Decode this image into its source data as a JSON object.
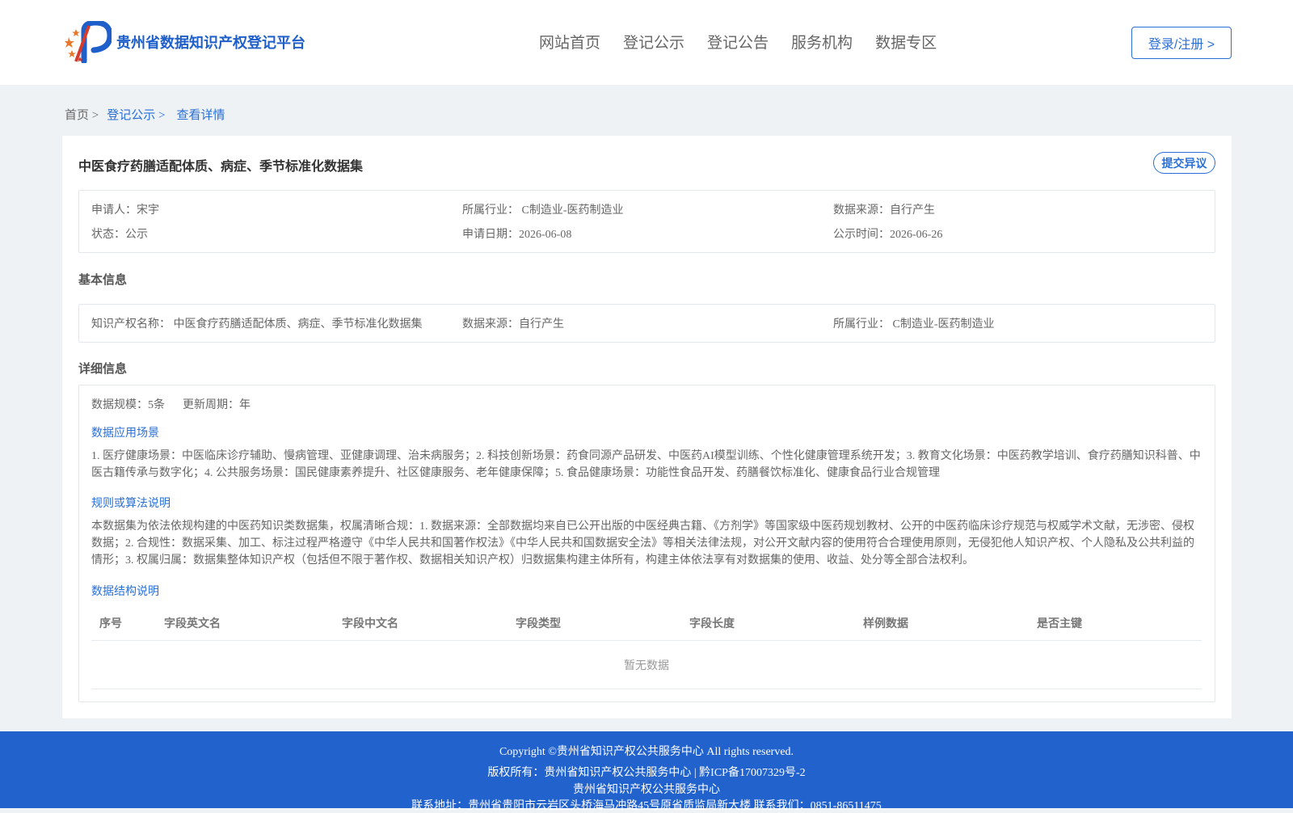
{
  "header": {
    "logo_text": "贵州省数据知识产权登记平台",
    "nav": [
      "网站首页",
      "登记公示",
      "登记公告",
      "服务机构",
      "数据专区"
    ],
    "login_label": "登录/注册 >"
  },
  "breadcrumb": {
    "home": "首页 >",
    "parent": "登记公示 >",
    "current": "查看详情"
  },
  "detail": {
    "title": "中医食疗药膳适配体质、病症、季节标准化数据集",
    "objection_label": "提交异议",
    "summary": {
      "applicant": "申请人：宋宇",
      "industry": "所属行业： C制造业-医药制造业",
      "source": "数据来源：自行产生",
      "status": "状态：公示",
      "apply_date": "申请日期：2026-06-08",
      "publish_time": "公示时间：2026-06-26"
    },
    "basic_title": "基本信息",
    "basic": {
      "ip_name": "知识产权名称： 中医食疗药膳适配体质、病症、季节标准化数据集",
      "source": "数据来源：自行产生",
      "industry": "所属行业： C制造业-医药制造业"
    },
    "detail_title": "详细信息",
    "scale": "数据规模：5条",
    "cycle": "更新周期：年",
    "scenario_title": "数据应用场景",
    "scenario_text": "1. 医疗健康场景：中医临床诊疗辅助、慢病管理、亚健康调理、治未病服务；2. 科技创新场景：药食同源产品研发、中医药AI模型训练、个性化健康管理系统开发；3. 教育文化场景：中医药教学培训、食疗药膳知识科普、中医古籍传承与数字化；4. 公共服务场景：国民健康素养提升、社区健康服务、老年健康保障；5. 食品健康场景：功能性食品开发、药膳餐饮标准化、健康食品行业合规管理",
    "rules_title": "规则或算法说明",
    "rules_text": "本数据集为依法依规构建的中医药知识类数据集，权属清晰合规：1. 数据来源：全部数据均来自已公开出版的中医经典古籍、《方剂学》等国家级中医药规划教材、公开的中医药临床诊疗规范与权威学术文献，无涉密、侵权数据；2. 合规性：数据采集、加工、标注过程严格遵守《中华人民共和国著作权法》《中华人民共和国数据安全法》等相关法律法规，对公开文献内容的使用符合合理使用原则，无侵犯他人知识产权、个人隐私及公共利益的情形；3. 权属归属：数据集整体知识产权（包括但不限于著作权、数据相关知识产权）归数据集构建主体所有，构建主体依法享有对数据集的使用、收益、处分等全部合法权利。",
    "structure_title": "数据结构说明",
    "table_headers": [
      "序号",
      "字段英文名",
      "字段中文名",
      "字段类型",
      "字段长度",
      "样例数据",
      "是否主键"
    ],
    "empty_text": "暂无数据"
  },
  "footer": {
    "copyright": "Copyright ©贵州省知识产权公共服务中心 All rights reserved.",
    "rights": "版权所有：贵州省知识产权公共服务中心 | 黔ICP备17007329号-2",
    "org": "贵州省知识产权公共服务中心",
    "address": "联系地址：贵州省贵阳市云岩区头桥海马冲路45号原省质监局新大楼 联系我们：0851-86511475"
  }
}
